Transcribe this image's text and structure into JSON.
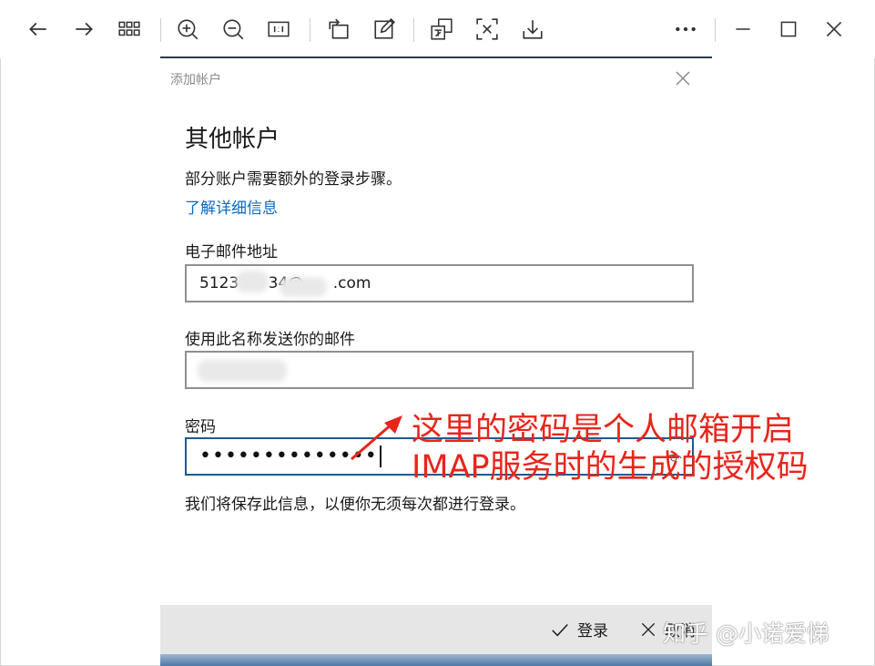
{
  "toolbar": {
    "icons": [
      "back-arrow-icon",
      "forward-arrow-icon",
      "grid-icon",
      "zoom-in-icon",
      "zoom-out-icon",
      "actual-size-icon",
      "rotate-icon",
      "edit-icon",
      "translate-icon",
      "ocr-icon",
      "download-icon",
      "more-icon",
      "minimize-icon",
      "maximize-icon",
      "close-icon"
    ]
  },
  "dialog": {
    "title": "添加帐户",
    "heading": "其他帐户",
    "description": "部分账户需要额外的登录步骤。",
    "learn_more": "了解详细信息",
    "email_label": "电子邮件地址",
    "email_value": "5123      34@      .com",
    "sender_label": "使用此名称发送你的邮件",
    "sender_value": "",
    "password_label": "密码",
    "password_value": "••••••••••••••",
    "save_note": "我们将保存此信息，以便你无须每次都进行登录。"
  },
  "commands": {
    "login_label": "登录",
    "cancel_label": "取消"
  },
  "annotation": {
    "line1": "这里的密码是个人邮箱开启",
    "line2": "IMAP服务时的生成的授权码",
    "color": "#e8251b"
  },
  "watermark": "知乎 @小诺爱悌"
}
